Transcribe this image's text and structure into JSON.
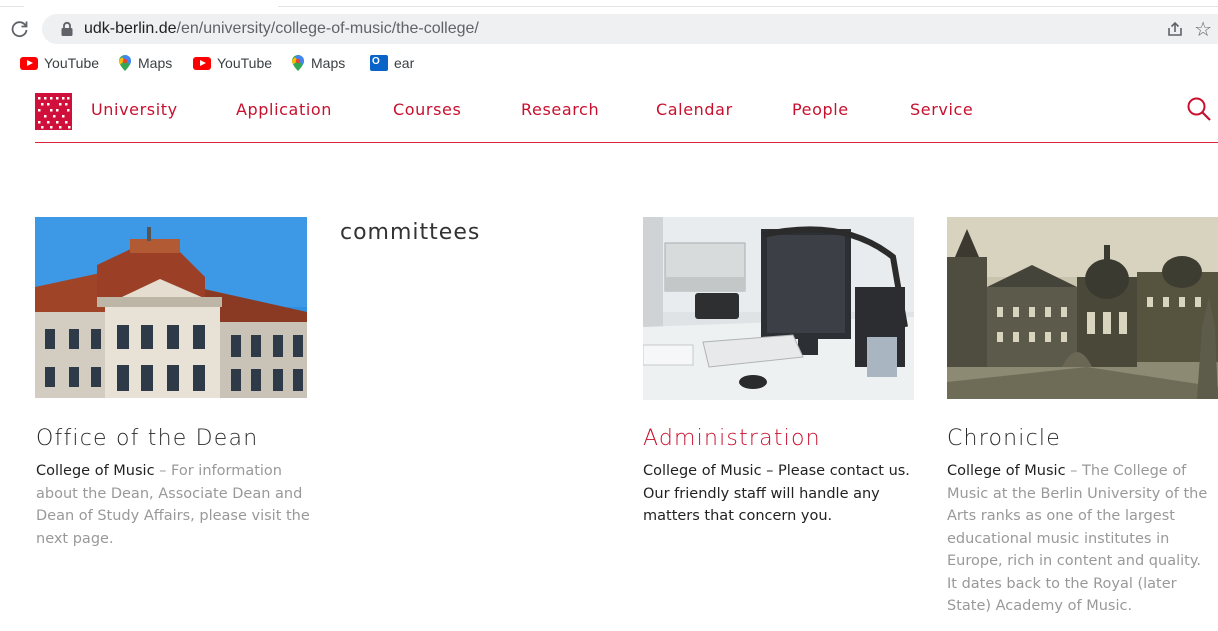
{
  "browser": {
    "url_host": "udk-berlin.de",
    "url_path": "/en/university/college-of-music/the-college/",
    "bookmarks": [
      {
        "label": "YouTube",
        "icon": "youtube-icon"
      },
      {
        "label": "Maps",
        "icon": "maps-icon"
      },
      {
        "label": "YouTube",
        "icon": "youtube-icon"
      },
      {
        "label": "Maps",
        "icon": "maps-icon"
      },
      {
        "label": "ear",
        "icon": "outlook-icon"
      }
    ]
  },
  "header": {
    "nav": [
      "University",
      "Application",
      "Courses",
      "Research",
      "Calendar",
      "People",
      "Service"
    ],
    "accent": "#c8102e"
  },
  "main": {
    "committees": "committees",
    "cards": [
      {
        "title": "Office of the Dean",
        "lead": "College of Music",
        "text": " – For information about the Dean, Associate Dean and Dean of Study Affairs, please visit the next page."
      },
      {
        "title": "Administration",
        "lead": "College of Music",
        "text": " – Please contact us. Our friendly staff will handle any matters that concern you."
      },
      {
        "title": "Chronicle",
        "lead": "College of Music",
        "text": " – The College of Music at the Berlin University of the Arts ranks as one of the largest educational music institutes in Europe, rich in content and quality. It dates back to the Royal (later State) Academy of Music."
      }
    ]
  }
}
